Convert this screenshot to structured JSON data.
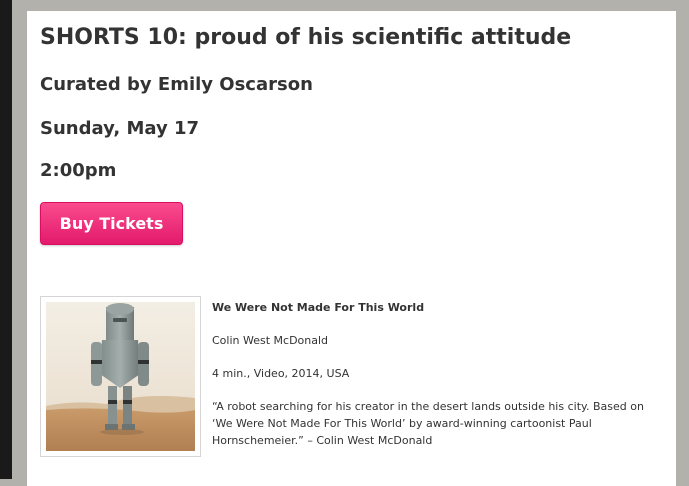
{
  "event": {
    "title": "SHORTS 10: proud of his scientific attitude",
    "curator": "Curated by Emily Oscarson",
    "date": "Sunday, May 17",
    "time": "2:00pm"
  },
  "buy_button": {
    "label": "Buy Tickets",
    "color": "#f0306f"
  },
  "film": {
    "title": "We Were Not Made For This World",
    "director": "Colin West McDonald",
    "meta": "4 min., Video, 2014, USA",
    "description": "“A robot searching for his creator in the desert lands outside his city. Based on ‘We Were Not Made For This World’ by award-winning cartoonist Paul Hornschemeier.” – Colin West McDonald"
  }
}
